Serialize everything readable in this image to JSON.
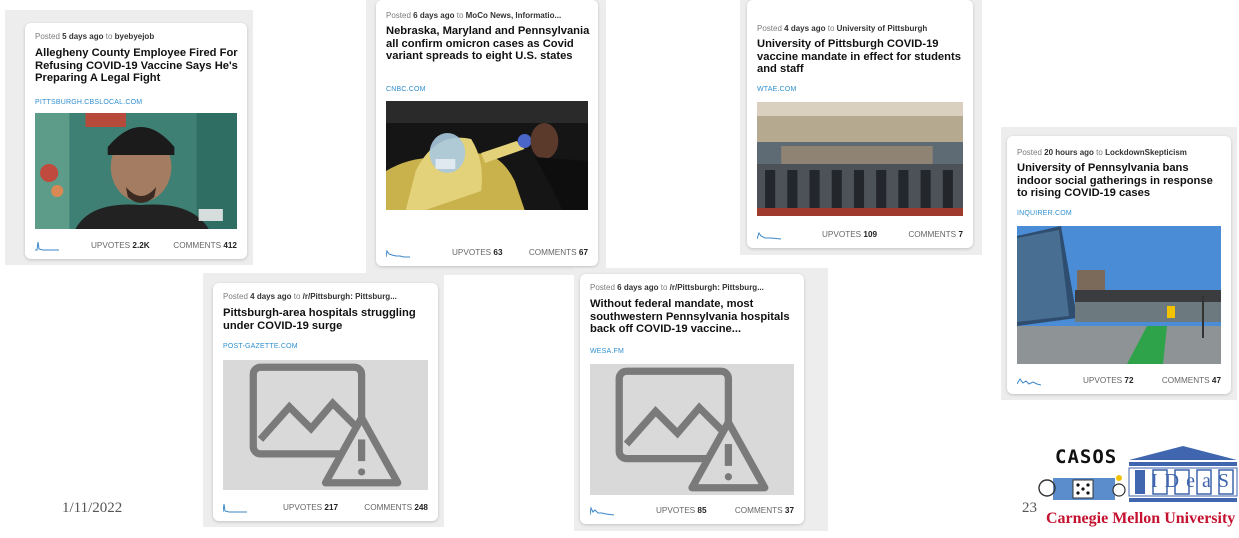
{
  "posts": [
    {
      "posted_prefix": "Posted",
      "age": "5 days ago",
      "to_word": "to",
      "community": "byebyejob",
      "title": "Allegheny County Employee Fired For Refusing COVID-19 Vaccine Says He's Preparing A Legal Fight",
      "domain": "PITTSBURGH.CBSLOCAL.COM",
      "upvotes_label": "UPVOTES",
      "upvotes": "2.2K",
      "comments_label": "COMMENTS",
      "comments": "412"
    },
    {
      "posted_prefix": "Posted",
      "age": "6 days ago",
      "to_word": "to",
      "community": "MoCo News, Informatio...",
      "title": "Nebraska, Maryland and Pennsylvania all confirm omicron cases as Covid variant spreads to eight U.S. states",
      "domain": "CNBC.COM",
      "upvotes_label": "UPVOTES",
      "upvotes": "63",
      "comments_label": "COMMENTS",
      "comments": "67"
    },
    {
      "posted_prefix": "Posted",
      "age": "4 days ago",
      "to_word": "to",
      "community": "University of Pittsburgh",
      "title": "University of Pittsburgh COVID-19 vaccine mandate in effect for students and staff",
      "domain": "WTAE.COM",
      "upvotes_label": "UPVOTES",
      "upvotes": "109",
      "comments_label": "COMMENTS",
      "comments": "7"
    },
    {
      "posted_prefix": "Posted",
      "age": "20 hours ago",
      "to_word": "to",
      "community": "LockdownSkepticism",
      "title": "University of Pennsylvania bans indoor social gatherings in response to rising COVID-19 cases",
      "domain": "INQUIRER.COM",
      "upvotes_label": "UPVOTES",
      "upvotes": "72",
      "comments_label": "COMMENTS",
      "comments": "47"
    },
    {
      "posted_prefix": "Posted",
      "age": "4 days ago",
      "to_word": "to",
      "community": "/r/Pittsburgh: Pittsburg...",
      "title": "Pittsburgh-area hospitals struggling under COVID-19 surge",
      "domain": "POST-GAZETTE.COM",
      "upvotes_label": "UPVOTES",
      "upvotes": "217",
      "comments_label": "COMMENTS",
      "comments": "248"
    },
    {
      "posted_prefix": "Posted",
      "age": "6 days ago",
      "to_word": "to",
      "community": "/r/Pittsburgh: Pittsburg...",
      "title": "Without federal mandate, most southwestern Pennsylvania hospitals back off COVID-19 vaccine...",
      "domain": "WESA.FM",
      "upvotes_label": "UPVOTES",
      "upvotes": "85",
      "comments_label": "COMMENTS",
      "comments": "37"
    }
  ],
  "slide": {
    "date": "1/11/2022",
    "page_number": "23"
  },
  "logo": {
    "casos": "CASOS",
    "ideas": "IDeaS",
    "university": "Carnegie Mellon University"
  },
  "colors": {
    "link": "#2f8fd0",
    "sparkline": "#3a86c8",
    "cmu_red": "#c41230",
    "ideas_blue": "#3f66ae"
  },
  "icons": {
    "broken_image": "broken-image-icon",
    "sparkline": "sparkline-icon"
  }
}
